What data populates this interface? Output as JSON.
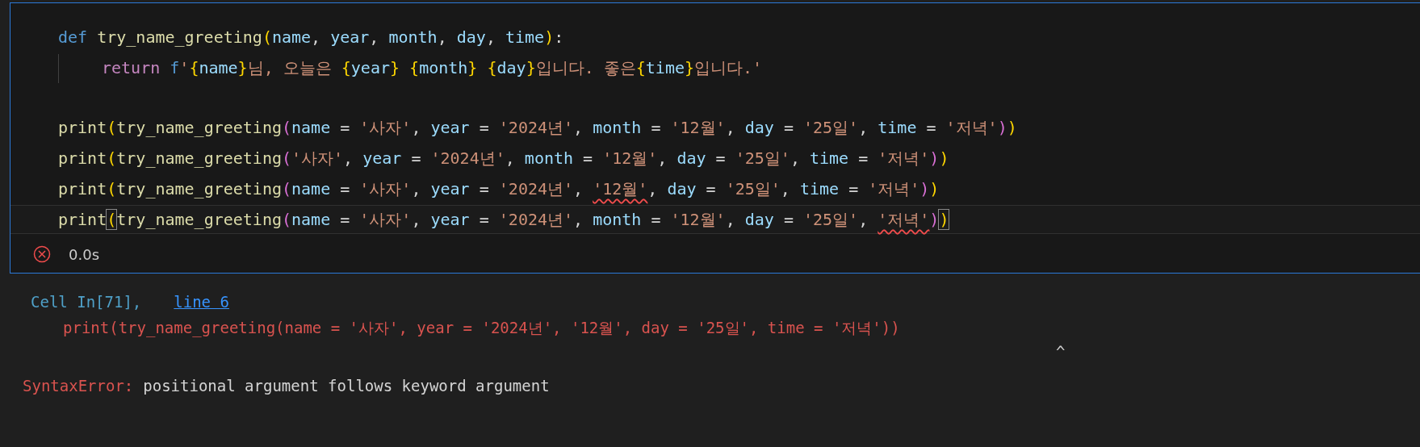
{
  "cell": {
    "lines": [
      {
        "kind": "code",
        "current": false,
        "indented": false,
        "tokens": [
          {
            "kind": "kw",
            "text": "def "
          },
          {
            "kind": "fn",
            "text": "try_name_greeting"
          },
          {
            "kind": "br1",
            "text": "("
          },
          {
            "kind": "var",
            "text": "name"
          },
          {
            "kind": "punct",
            "text": ", "
          },
          {
            "kind": "var",
            "text": "year"
          },
          {
            "kind": "punct",
            "text": ", "
          },
          {
            "kind": "var",
            "text": "month"
          },
          {
            "kind": "punct",
            "text": ", "
          },
          {
            "kind": "var",
            "text": "day"
          },
          {
            "kind": "punct",
            "text": ", "
          },
          {
            "kind": "var",
            "text": "time"
          },
          {
            "kind": "br1",
            "text": ")"
          },
          {
            "kind": "punct",
            "text": ":"
          }
        ]
      },
      {
        "kind": "code",
        "current": false,
        "indented": true,
        "tokens": [
          {
            "kind": "ctrl",
            "text": "return "
          },
          {
            "kind": "kw",
            "text": "f"
          },
          {
            "kind": "str",
            "text": "'"
          },
          {
            "kind": "br1",
            "text": "{"
          },
          {
            "kind": "var",
            "text": "name"
          },
          {
            "kind": "br1",
            "text": "}"
          },
          {
            "kind": "str",
            "text": "님, 오늘은 "
          },
          {
            "kind": "br1",
            "text": "{"
          },
          {
            "kind": "var",
            "text": "year"
          },
          {
            "kind": "br1",
            "text": "}"
          },
          {
            "kind": "br1",
            "text": " {"
          },
          {
            "kind": "var",
            "text": "month"
          },
          {
            "kind": "br1",
            "text": "}"
          },
          {
            "kind": "br1",
            "text": " {"
          },
          {
            "kind": "var",
            "text": "day"
          },
          {
            "kind": "br1",
            "text": "}"
          },
          {
            "kind": "str",
            "text": "입니다. 좋은"
          },
          {
            "kind": "br1",
            "text": "{"
          },
          {
            "kind": "var",
            "text": "time"
          },
          {
            "kind": "br1",
            "text": "}"
          },
          {
            "kind": "str",
            "text": "입니다.'"
          }
        ]
      },
      {
        "kind": "blank"
      },
      {
        "kind": "code",
        "current": false,
        "indented": false,
        "tokens": [
          {
            "kind": "fn",
            "text": "print"
          },
          {
            "kind": "br1",
            "text": "("
          },
          {
            "kind": "fn",
            "text": "try_name_greeting"
          },
          {
            "kind": "br2",
            "text": "("
          },
          {
            "kind": "var",
            "text": "name"
          },
          {
            "kind": "punct",
            "text": " = "
          },
          {
            "kind": "str",
            "text": "'사자'"
          },
          {
            "kind": "punct",
            "text": ", "
          },
          {
            "kind": "var",
            "text": "year"
          },
          {
            "kind": "punct",
            "text": " = "
          },
          {
            "kind": "str",
            "text": "'2024년'"
          },
          {
            "kind": "punct",
            "text": ", "
          },
          {
            "kind": "var",
            "text": "month"
          },
          {
            "kind": "punct",
            "text": " = "
          },
          {
            "kind": "str",
            "text": "'12월'"
          },
          {
            "kind": "punct",
            "text": ", "
          },
          {
            "kind": "var",
            "text": "day"
          },
          {
            "kind": "punct",
            "text": " = "
          },
          {
            "kind": "str",
            "text": "'25일'"
          },
          {
            "kind": "punct",
            "text": ", "
          },
          {
            "kind": "var",
            "text": "time"
          },
          {
            "kind": "punct",
            "text": " = "
          },
          {
            "kind": "str",
            "text": "'저녁'"
          },
          {
            "kind": "br2",
            "text": ")"
          },
          {
            "kind": "br1",
            "text": ")"
          }
        ]
      },
      {
        "kind": "code",
        "current": false,
        "indented": false,
        "tokens": [
          {
            "kind": "fn",
            "text": "print"
          },
          {
            "kind": "br1",
            "text": "("
          },
          {
            "kind": "fn",
            "text": "try_name_greeting"
          },
          {
            "kind": "br2",
            "text": "("
          },
          {
            "kind": "str",
            "text": "'사자'"
          },
          {
            "kind": "punct",
            "text": ", "
          },
          {
            "kind": "var",
            "text": "year"
          },
          {
            "kind": "punct",
            "text": " = "
          },
          {
            "kind": "str",
            "text": "'2024년'"
          },
          {
            "kind": "punct",
            "text": ", "
          },
          {
            "kind": "var",
            "text": "month"
          },
          {
            "kind": "punct",
            "text": " = "
          },
          {
            "kind": "str",
            "text": "'12월'"
          },
          {
            "kind": "punct",
            "text": ", "
          },
          {
            "kind": "var",
            "text": "day"
          },
          {
            "kind": "punct",
            "text": " = "
          },
          {
            "kind": "str",
            "text": "'25일'"
          },
          {
            "kind": "punct",
            "text": ", "
          },
          {
            "kind": "var",
            "text": "time"
          },
          {
            "kind": "punct",
            "text": " = "
          },
          {
            "kind": "str",
            "text": "'저녁'"
          },
          {
            "kind": "br2",
            "text": ")"
          },
          {
            "kind": "br1",
            "text": ")"
          }
        ]
      },
      {
        "kind": "code",
        "current": false,
        "indented": false,
        "tokens": [
          {
            "kind": "fn",
            "text": "print"
          },
          {
            "kind": "br1",
            "text": "("
          },
          {
            "kind": "fn",
            "text": "try_name_greeting"
          },
          {
            "kind": "br2",
            "text": "("
          },
          {
            "kind": "var",
            "text": "name"
          },
          {
            "kind": "punct",
            "text": " = "
          },
          {
            "kind": "str",
            "text": "'사자'"
          },
          {
            "kind": "punct",
            "text": ", "
          },
          {
            "kind": "var",
            "text": "year"
          },
          {
            "kind": "punct",
            "text": " = "
          },
          {
            "kind": "str",
            "text": "'2024년'"
          },
          {
            "kind": "punct",
            "text": ", "
          },
          {
            "kind": "str",
            "text": "'12월'",
            "error": true
          },
          {
            "kind": "punct",
            "text": ", "
          },
          {
            "kind": "var",
            "text": "day"
          },
          {
            "kind": "punct",
            "text": " = "
          },
          {
            "kind": "str",
            "text": "'25일'"
          },
          {
            "kind": "punct",
            "text": ", "
          },
          {
            "kind": "var",
            "text": "time"
          },
          {
            "kind": "punct",
            "text": " = "
          },
          {
            "kind": "str",
            "text": "'저녁'"
          },
          {
            "kind": "br2",
            "text": ")"
          },
          {
            "kind": "br1",
            "text": ")"
          }
        ]
      },
      {
        "kind": "code",
        "current": true,
        "indented": false,
        "tokens": [
          {
            "kind": "fn",
            "text": "print"
          },
          {
            "kind": "br1",
            "text": "(",
            "matched": true
          },
          {
            "kind": "fn",
            "text": "try_name_greeting"
          },
          {
            "kind": "br2",
            "text": "("
          },
          {
            "kind": "var",
            "text": "name"
          },
          {
            "kind": "punct",
            "text": " = "
          },
          {
            "kind": "str",
            "text": "'사자'"
          },
          {
            "kind": "punct",
            "text": ", "
          },
          {
            "kind": "var",
            "text": "year"
          },
          {
            "kind": "punct",
            "text": " = "
          },
          {
            "kind": "str",
            "text": "'2024년'"
          },
          {
            "kind": "punct",
            "text": ", "
          },
          {
            "kind": "var",
            "text": "month"
          },
          {
            "kind": "punct",
            "text": " = "
          },
          {
            "kind": "str",
            "text": "'12월'"
          },
          {
            "kind": "punct",
            "text": ", "
          },
          {
            "kind": "var",
            "text": "day"
          },
          {
            "kind": "punct",
            "text": " = "
          },
          {
            "kind": "str",
            "text": "'25일'"
          },
          {
            "kind": "punct",
            "text": ", "
          },
          {
            "kind": "str",
            "text": "'저녁'",
            "error": true
          },
          {
            "kind": "br2",
            "text": ")"
          },
          {
            "kind": "br1",
            "text": ")",
            "matched": true
          }
        ]
      }
    ],
    "status": {
      "duration": "0.0s"
    }
  },
  "output": {
    "location": {
      "cell_label": "Cell In[71],",
      "link": "line 6"
    },
    "source_line": "print(try_name_greeting(name = '사자', year = '2024년', '12월', day = '25일', time = '저녁'))",
    "caret": "^",
    "error_type": "SyntaxError:",
    "error_message": "positional argument follows keyword argument"
  }
}
